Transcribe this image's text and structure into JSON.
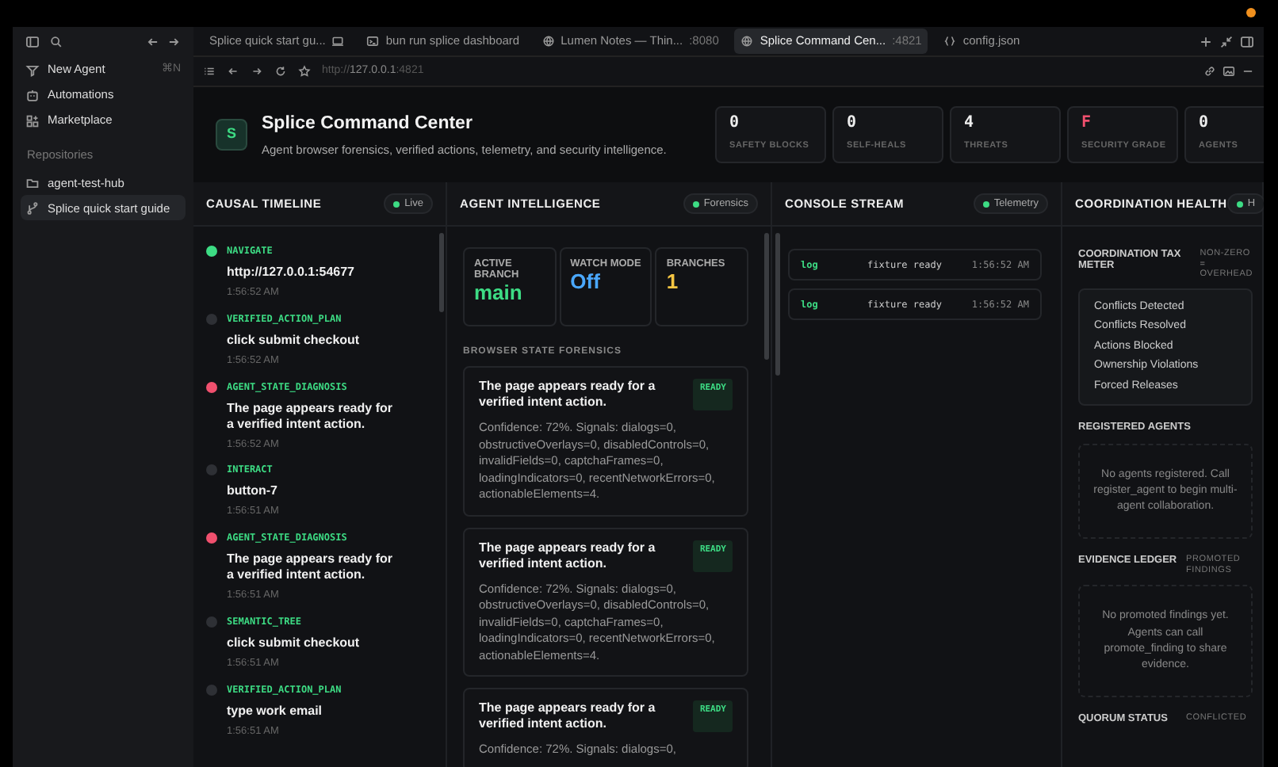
{
  "sidebar": {
    "items": [
      {
        "label": "New Agent",
        "shortcut": "⌘N",
        "kind": "agent"
      },
      {
        "label": "Automations",
        "kind": "automation"
      },
      {
        "label": "Marketplace",
        "kind": "market"
      }
    ],
    "section": "Repositories",
    "repos": [
      {
        "label": "agent-test-hub",
        "kind": "folder",
        "selected": false
      },
      {
        "label": "Splice quick start guide",
        "kind": "branch",
        "selected": true
      }
    ]
  },
  "tabs": [
    {
      "label": "Splice quick start gu...",
      "kind": "page",
      "selected": false
    },
    {
      "label": "bun run splice dashboard",
      "kind": "terminal",
      "selected": false
    },
    {
      "label": "Lumen Notes — Thin...",
      "port": ":8080",
      "kind": "web",
      "selected": false
    },
    {
      "label": "Splice Command Cen...",
      "port": ":4821",
      "kind": "web",
      "selected": true
    },
    {
      "label": "config.json",
      "kind": "file",
      "selected": false
    }
  ],
  "address": {
    "scheme": "http://",
    "host": "127.0.0.1",
    "port": ":4821"
  },
  "header": {
    "logo": "S",
    "title": "Splice Command Center",
    "subtitle": "Agent browser forensics, verified actions, telemetry, and security intelligence.",
    "stats": [
      {
        "value": "0",
        "label": "SAFETY BLOCKS",
        "alert": false
      },
      {
        "value": "0",
        "label": "SELF-HEALS",
        "alert": false
      },
      {
        "value": "4",
        "label": "THREATS",
        "alert": false
      },
      {
        "value": "F",
        "label": "SECURITY GRADE",
        "alert": true
      },
      {
        "value": "0",
        "label": "AGENTS",
        "alert": false
      }
    ]
  },
  "timeline": {
    "title": "CAUSAL TIMELINE",
    "badge": "Live",
    "events": [
      {
        "type": "NAVIGATE",
        "detail": "http://127.0.0.1:54677",
        "time": "1:56:52 AM",
        "color": "#3ddc84"
      },
      {
        "type": "VERIFIED_ACTION_PLAN",
        "detail": "click submit checkout",
        "time": "1:56:52 AM",
        "color": "#2e3035"
      },
      {
        "type": "AGENT_STATE_DIAGNOSIS",
        "detail": "The page appears ready for a verified intent action.",
        "time": "1:56:52 AM",
        "color": "#f0506e"
      },
      {
        "type": "INTERACT",
        "detail": "button-7",
        "time": "1:56:51 AM",
        "color": "#2e3035"
      },
      {
        "type": "AGENT_STATE_DIAGNOSIS",
        "detail": "The page appears ready for a verified intent action.",
        "time": "1:56:51 AM",
        "color": "#f0506e"
      },
      {
        "type": "SEMANTIC_TREE",
        "detail": "click submit checkout",
        "time": "1:56:51 AM",
        "color": "#2e3035"
      },
      {
        "type": "VERIFIED_ACTION_PLAN",
        "detail": "type work email",
        "time": "1:56:51 AM",
        "color": "#2e3035"
      }
    ]
  },
  "intelligence": {
    "title": "AGENT INTELLIGENCE",
    "badge": "Forensics",
    "metrics": [
      {
        "label": "ACTIVE BRANCH",
        "value": "main",
        "color": "#3ddc84"
      },
      {
        "label": "WATCH MODE",
        "value": "Off",
        "color": "#4aa8ff"
      },
      {
        "label": "BRANCHES",
        "value": "1",
        "color": "#f5c542"
      }
    ],
    "section": "BROWSER STATE FORENSICS",
    "findings": [
      {
        "title": "The page appears ready for a verified intent action.",
        "status": "READY",
        "body": "Confidence: 72%. Signals: dialogs=0, obstructiveOverlays=0, disabledControls=0, invalidFields=0, captchaFrames=0, loadingIndicators=0, recentNetworkErrors=0, actionableElements=4."
      },
      {
        "title": "The page appears ready for a verified intent action.",
        "status": "READY",
        "body": "Confidence: 72%. Signals: dialogs=0, obstructiveOverlays=0, disabledControls=0, invalidFields=0, captchaFrames=0, loadingIndicators=0, recentNetworkErrors=0, actionableElements=4."
      },
      {
        "title": "The page appears ready for a verified intent action.",
        "status": "READY",
        "body": "Confidence: 72%. Signals: dialogs=0,"
      }
    ]
  },
  "console": {
    "title": "CONSOLE STREAM",
    "badge": "Telemetry",
    "entries": [
      {
        "level": "log",
        "message": "fixture ready",
        "time": "1:56:52 AM"
      },
      {
        "level": "log",
        "message": "fixture ready",
        "time": "1:56:52 AM"
      }
    ]
  },
  "coordination": {
    "title": "COORDINATION HEALTH",
    "badge": "H",
    "tax": {
      "title": "COORDINATION TAX METER",
      "note": "NON-ZERO = OVERHEAD",
      "rows": [
        "Conflicts Detected",
        "Conflicts Resolved",
        "Actions Blocked",
        "Ownership Violations",
        "Forced Releases"
      ]
    },
    "agents": {
      "title": "REGISTERED AGENTS",
      "empty": "No agents registered. Call register_agent to begin multi-agent collaboration."
    },
    "ledger": {
      "title": "EVIDENCE LEDGER",
      "note": "PROMOTED FINDINGS",
      "empty": "No promoted findings yet. Agents can call promote_finding to share evidence."
    },
    "quorum": {
      "title": "QUORUM STATUS",
      "note": "CONFLICTED"
    }
  }
}
